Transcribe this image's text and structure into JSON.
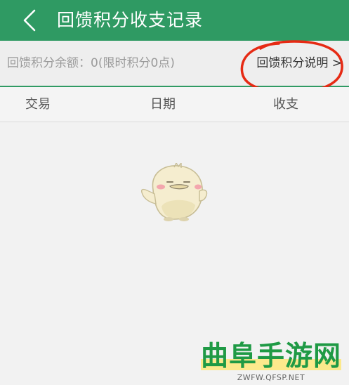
{
  "header": {
    "title": "回馈积分收支记录"
  },
  "info": {
    "balance_text": "回馈积分余额：0(限时积分0点)",
    "explain_link": "回馈积分说明 >"
  },
  "table": {
    "columns": [
      "交易",
      "日期",
      "收支"
    ]
  },
  "watermark": {
    "name": "曲阜手游网",
    "url": "ZWFW.QFSP.NET"
  },
  "colors": {
    "header_bg": "#2f9a63",
    "annotation": "#e62a14",
    "watermark_text": "#1f9a45"
  },
  "icons": [
    "back-chevron-icon",
    "empty-mascot-illustration"
  ]
}
